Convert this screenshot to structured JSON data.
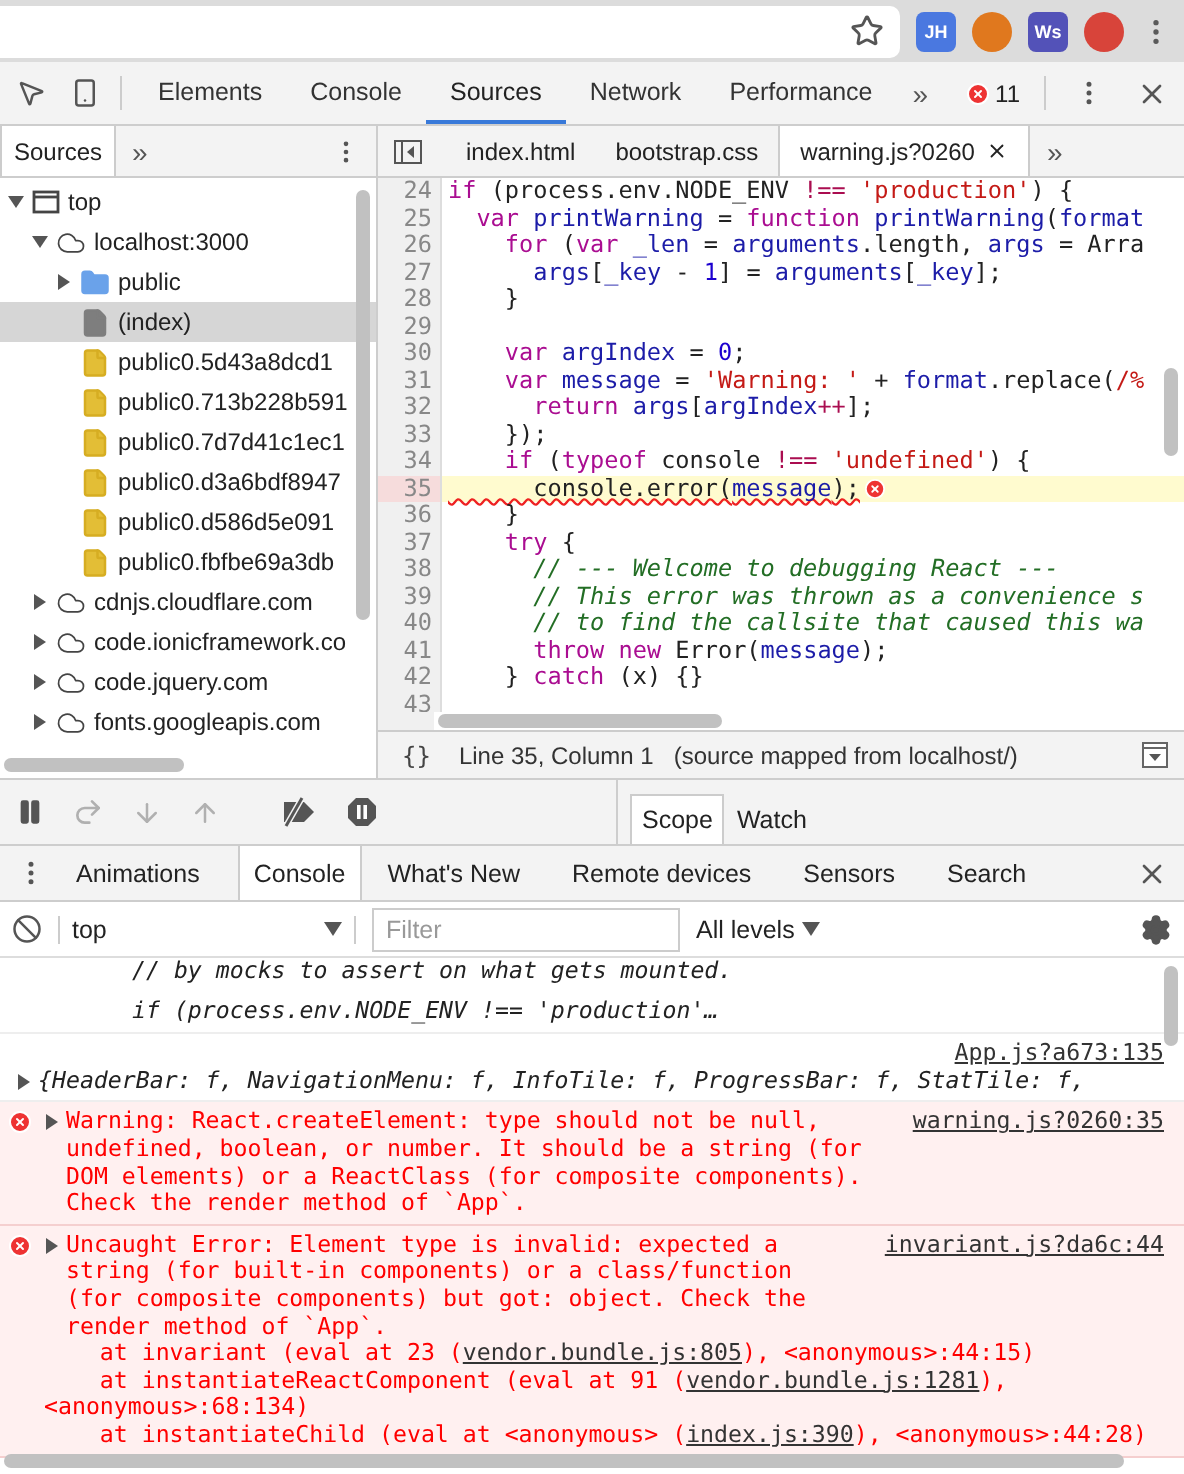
{
  "browser": {
    "extensions": [
      {
        "label": "JH",
        "color": "#4a78e0"
      },
      {
        "color": "#e0781e"
      },
      {
        "label": "Ws",
        "color": "#5352b8"
      },
      {
        "color": "#d8443a"
      }
    ]
  },
  "devtools": {
    "tabs": [
      {
        "label": "Elements",
        "selected": false
      },
      {
        "label": "Console",
        "selected": false
      },
      {
        "label": "Sources",
        "selected": true
      },
      {
        "label": "Network",
        "selected": false
      },
      {
        "label": "Performance",
        "selected": false
      }
    ],
    "overflow": "»",
    "error_count": "11"
  },
  "navigator": {
    "tabs": [
      {
        "label": "Sources",
        "selected": true
      }
    ],
    "overflow": "»",
    "tree": [
      {
        "label": "top",
        "kind": "frame",
        "expanded": true,
        "selected": false,
        "children": [
          {
            "label": "localhost:3000",
            "kind": "domain",
            "expanded": true,
            "selected": false,
            "children": [
              {
                "label": "public",
                "kind": "folder",
                "expanded": false,
                "selected": false
              },
              {
                "label": "(index)",
                "kind": "page",
                "selected": true
              },
              {
                "label": "public0.5d43a8dcd1",
                "kind": "script",
                "selected": false
              },
              {
                "label": "public0.713b228b591",
                "kind": "script",
                "selected": false
              },
              {
                "label": "public0.7d7d41c1ec1",
                "kind": "script",
                "selected": false
              },
              {
                "label": "public0.d3a6bdf8947",
                "kind": "script",
                "selected": false
              },
              {
                "label": "public0.d586d5e091",
                "kind": "script",
                "selected": false
              },
              {
                "label": "public0.fbfbe69a3db",
                "kind": "script",
                "selected": false
              }
            ]
          },
          {
            "label": "cdnjs.cloudflare.com",
            "kind": "domain",
            "expanded": false,
            "selected": false
          },
          {
            "label": "code.ionicframework.co",
            "kind": "domain",
            "expanded": false,
            "selected": false
          },
          {
            "label": "code.jquery.com",
            "kind": "domain",
            "expanded": false,
            "selected": false
          },
          {
            "label": "fonts.googleapis.com",
            "kind": "domain",
            "expanded": false,
            "selected": false
          }
        ]
      }
    ]
  },
  "editor": {
    "tabs": [
      {
        "label": "index.html",
        "selected": false,
        "closable": false
      },
      {
        "label": "bootstrap.css",
        "selected": false,
        "closable": false
      },
      {
        "label": "warning.js?0260",
        "selected": true,
        "closable": true
      }
    ],
    "overflow": "»",
    "lines": [
      {
        "number": "24",
        "error": false,
        "tokens": [
          {
            "kind": "kw",
            "text": "if"
          },
          {
            "kind": "plain",
            "text": " (process.env.NODE_ENV "
          },
          {
            "kind": "op",
            "text": "!=="
          },
          {
            "kind": "str",
            "text": " 'production'"
          },
          {
            "kind": "plain",
            "text": ") {"
          }
        ]
      },
      {
        "number": "25",
        "error": false,
        "tokens": [
          {
            "kind": "kw",
            "text": "  var"
          },
          {
            "kind": "name",
            "text": " printWarning"
          },
          {
            "kind": "plain",
            "text": " = "
          },
          {
            "kind": "kw",
            "text": "function"
          },
          {
            "kind": "name",
            "text": " printWarning"
          },
          {
            "kind": "plain",
            "text": "("
          },
          {
            "kind": "name",
            "text": "format"
          }
        ]
      },
      {
        "number": "26",
        "error": false,
        "tokens": [
          {
            "kind": "kw",
            "text": "    for"
          },
          {
            "kind": "plain",
            "text": " ("
          },
          {
            "kind": "kw",
            "text": "var"
          },
          {
            "kind": "name",
            "text": " _len"
          },
          {
            "kind": "plain",
            "text": " = "
          },
          {
            "kind": "name",
            "text": "arguments"
          },
          {
            "kind": "plain",
            "text": ".length, "
          },
          {
            "kind": "name",
            "text": "args"
          },
          {
            "kind": "plain",
            "text": " = Arra"
          }
        ]
      },
      {
        "number": "27",
        "error": false,
        "tokens": [
          {
            "kind": "name",
            "text": "      args"
          },
          {
            "kind": "plain",
            "text": "["
          },
          {
            "kind": "name",
            "text": "_key"
          },
          {
            "kind": "plain",
            "text": " - "
          },
          {
            "kind": "num",
            "text": "1"
          },
          {
            "kind": "plain",
            "text": "] = "
          },
          {
            "kind": "name",
            "text": "arguments"
          },
          {
            "kind": "plain",
            "text": "["
          },
          {
            "kind": "name",
            "text": "_key"
          },
          {
            "kind": "plain",
            "text": "];"
          }
        ]
      },
      {
        "number": "28",
        "error": false,
        "tokens": [
          {
            "kind": "plain",
            "text": "    }"
          }
        ]
      },
      {
        "number": "29",
        "error": false
      },
      {
        "number": "30",
        "error": false,
        "tokens": [
          {
            "kind": "kw",
            "text": "    var"
          },
          {
            "kind": "name",
            "text": " argIndex"
          },
          {
            "kind": "plain",
            "text": " = "
          },
          {
            "kind": "num",
            "text": "0"
          },
          {
            "kind": "plain",
            "text": ";"
          }
        ]
      },
      {
        "number": "31",
        "error": false,
        "tokens": [
          {
            "kind": "kw",
            "text": "    var"
          },
          {
            "kind": "name",
            "text": " message"
          },
          {
            "kind": "plain",
            "text": " = "
          },
          {
            "kind": "str",
            "text": "'Warning: '"
          },
          {
            "kind": "plain",
            "text": " + "
          },
          {
            "kind": "name",
            "text": "format"
          },
          {
            "kind": "plain",
            "text": ".replace("
          },
          {
            "kind": "str",
            "text": "/%"
          }
        ]
      },
      {
        "number": "32",
        "error": false,
        "tokens": [
          {
            "kind": "kw",
            "text": "      return"
          },
          {
            "kind": "name",
            "text": " args"
          },
          {
            "kind": "plain",
            "text": "["
          },
          {
            "kind": "name",
            "text": "argIndex"
          },
          {
            "kind": "op",
            "text": "++"
          },
          {
            "kind": "plain",
            "text": "];"
          }
        ]
      },
      {
        "number": "33",
        "error": false,
        "tokens": [
          {
            "kind": "plain",
            "text": "    });"
          }
        ]
      },
      {
        "number": "34",
        "error": false,
        "tokens": [
          {
            "kind": "kw",
            "text": "    if"
          },
          {
            "kind": "plain",
            "text": " ("
          },
          {
            "kind": "kw",
            "text": "typeof"
          },
          {
            "kind": "plain",
            "text": " console "
          },
          {
            "kind": "op",
            "text": "!=="
          },
          {
            "kind": "str",
            "text": " 'undefined'"
          },
          {
            "kind": "plain",
            "text": ") {"
          }
        ]
      },
      {
        "number": "35",
        "error": true,
        "tokens": [
          {
            "kind": "plain",
            "text": "      console.error("
          },
          {
            "kind": "name",
            "text": "message"
          },
          {
            "kind": "plain",
            "text": ");"
          }
        ]
      },
      {
        "number": "36",
        "error": false,
        "tokens": [
          {
            "kind": "plain",
            "text": "    }"
          }
        ]
      },
      {
        "number": "37",
        "error": false,
        "tokens": [
          {
            "kind": "kw",
            "text": "    try"
          },
          {
            "kind": "plain",
            "text": " {"
          }
        ]
      },
      {
        "number": "38",
        "error": false,
        "tokens": [
          {
            "kind": "cmt",
            "text": "      // --- Welcome to debugging React ---"
          }
        ]
      },
      {
        "number": "39",
        "error": false,
        "tokens": [
          {
            "kind": "cmt",
            "text": "      // This error was thrown as a convenience s"
          }
        ]
      },
      {
        "number": "40",
        "error": false,
        "tokens": [
          {
            "kind": "cmt",
            "text": "      // to find the callsite that caused this wa"
          }
        ]
      },
      {
        "number": "41",
        "error": false,
        "tokens": [
          {
            "kind": "kw",
            "text": "      throw"
          },
          {
            "kind": "kw",
            "text": " new"
          },
          {
            "kind": "plain",
            "text": " Error("
          },
          {
            "kind": "name",
            "text": "message"
          },
          {
            "kind": "plain",
            "text": ");"
          }
        ]
      },
      {
        "number": "42",
        "error": false,
        "tokens": [
          {
            "kind": "plain",
            "text": "    } "
          },
          {
            "kind": "kw",
            "text": "catch"
          },
          {
            "kind": "plain",
            "text": " (x) {}"
          }
        ]
      },
      {
        "number": "43",
        "error": false
      }
    ],
    "status": {
      "format_button": "{}",
      "position": "Line 35, Column 1",
      "mapping": "(source mapped from localhost/)"
    }
  },
  "debugger": {
    "controls": [
      {
        "kind": "pause",
        "disabled": false
      },
      {
        "kind": "step-over",
        "disabled": true
      },
      {
        "kind": "step-into",
        "disabled": true
      },
      {
        "kind": "step-out",
        "disabled": true
      },
      {
        "kind": "deactivate",
        "disabled": false
      },
      {
        "kind": "pause-exceptions",
        "disabled": false
      }
    ],
    "tabs": [
      {
        "label": "Scope",
        "selected": true
      },
      {
        "label": "Watch",
        "selected": false
      }
    ]
  },
  "drawer": {
    "tabs": [
      {
        "label": "Animations",
        "selected": false
      },
      {
        "label": "Console",
        "selected": true
      },
      {
        "label": "What's New",
        "selected": false
      },
      {
        "label": "Remote devices",
        "selected": false
      },
      {
        "label": "Sensors",
        "selected": false
      },
      {
        "label": "Search",
        "selected": false
      }
    ]
  },
  "console": {
    "context": "top",
    "filter_placeholder": "Filter",
    "levels": "All levels",
    "messages": [
      {
        "kind": "continuation",
        "lines": [
          "// by mocks to assert on what gets mounted.",
          "if (process.env.NODE_ENV !== 'production'…"
        ]
      },
      {
        "kind": "log",
        "source": "App.js?a673:135",
        "text": "{HeaderBar: f, NavigationMenu: f, InfoTile: f, ProgressBar: f, StatTile: f,"
      },
      {
        "kind": "error",
        "source": "warning.js?0260:35",
        "text": "Warning: React.createElement: type should not be null, undefined, boolean, or number. It should be a string (for DOM elements) or a ReactClass (for composite components). Check the render method of `App`."
      },
      {
        "kind": "error",
        "source": "invariant.js?da6c:44",
        "text": "Uncaught Error: Element type is invalid: expected a string (for built-in components) or a class/function (for composite components) but got: object. Check the render method of `App`.",
        "stack": [
          [
            {
              "kind": "text",
              "text": "at invariant (eval at 23 ("
            },
            {
              "kind": "link",
              "text": "vendor.bundle.js:805"
            },
            {
              "kind": "text",
              "text": "), <anonymous>:44:15)"
            }
          ],
          [
            {
              "kind": "text",
              "text": "at instantiateReactComponent (eval at 91 ("
            },
            {
              "kind": "link",
              "text": "vendor.bundle.js:1281"
            },
            {
              "kind": "text",
              "text": "), <anonymous>:68:134)"
            }
          ],
          [
            {
              "kind": "text",
              "text": "at instantiateChild (eval at <anonymous> ("
            },
            {
              "kind": "link",
              "text": "index.js:390"
            },
            {
              "kind": "text",
              "text": "), <anonymous>:44:28)"
            }
          ]
        ]
      }
    ]
  }
}
